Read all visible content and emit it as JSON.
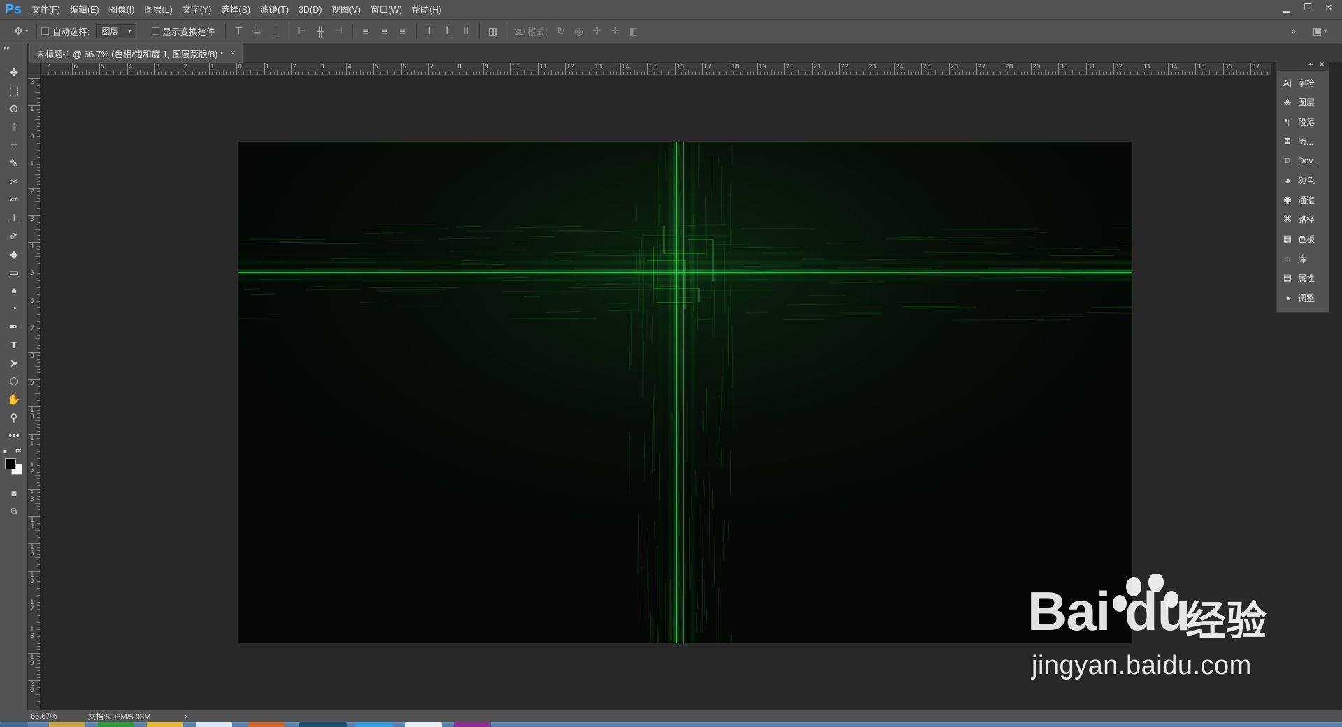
{
  "app": {
    "logo": "Ps",
    "accent_color": "#31a8ff"
  },
  "menu": [
    "文件(F)",
    "编辑(E)",
    "图像(I)",
    "图层(L)",
    "文字(Y)",
    "选择(S)",
    "滤镜(T)",
    "3D(D)",
    "视图(V)",
    "窗口(W)",
    "帮助(H)"
  ],
  "window_controls": {
    "minimize_icon": "minimize-icon",
    "restore_icon": "restore-icon",
    "close_icon": "close-icon"
  },
  "options_bar": {
    "tool_icon": "move-tool-icon",
    "auto_select_label": "自动选择:",
    "auto_select_checked": false,
    "auto_select_value": "图层",
    "show_transform_label": "显示变换控件",
    "show_transform_checked": false,
    "mode_3d_label": "3D 模式:"
  },
  "document_tab": {
    "title": "未标题-1 @ 66.7% (色相/饱和度 1, 图层蒙版/8) *",
    "close": "×"
  },
  "rulers": {
    "horizontal": [
      "7",
      "6",
      "5",
      "4",
      "3",
      "2",
      "1",
      "0",
      "1",
      "2",
      "3",
      "4",
      "5",
      "6",
      "7",
      "8",
      "9",
      "10",
      "11",
      "12",
      "13",
      "14",
      "15",
      "16",
      "17",
      "18",
      "19",
      "20",
      "21",
      "22",
      "23",
      "24",
      "25",
      "26",
      "27",
      "28",
      "29",
      "30",
      "31",
      "32",
      "33",
      "34",
      "35",
      "36",
      "37"
    ],
    "vertical": [
      "2",
      "1",
      "0",
      "1",
      "2",
      "3",
      "4",
      "5",
      "6",
      "7",
      "8",
      "9",
      "10",
      "11",
      "12",
      "13",
      "14",
      "15",
      "16",
      "17",
      "18",
      "19",
      "20"
    ]
  },
  "right_panel": [
    {
      "icon": "character-icon",
      "label": "字符"
    },
    {
      "icon": "layers-icon",
      "label": "图层"
    },
    {
      "icon": "paragraph-icon",
      "label": "段落"
    },
    {
      "icon": "history-icon",
      "label": "历..."
    },
    {
      "icon": "device-preview-icon",
      "label": "Dev..."
    },
    {
      "icon": "color-icon",
      "label": "颜色"
    },
    {
      "icon": "channels-icon",
      "label": "通道"
    },
    {
      "icon": "paths-icon",
      "label": "路径"
    },
    {
      "icon": "swatches-icon",
      "label": "色板"
    },
    {
      "icon": "libraries-icon",
      "label": "库"
    },
    {
      "icon": "properties-icon",
      "label": "属性"
    },
    {
      "icon": "adjustments-icon",
      "label": "调整"
    }
  ],
  "status_bar": {
    "zoom": "66.67%",
    "doc_size": "文档:5.93M/5.93M",
    "arrow": "›"
  },
  "canvas": {
    "background_color": "#050805",
    "glow_color": "#28c43c"
  },
  "watermark": {
    "brand": "Bai du",
    "cn": "经验",
    "url": "jingyan.baidu.com"
  }
}
